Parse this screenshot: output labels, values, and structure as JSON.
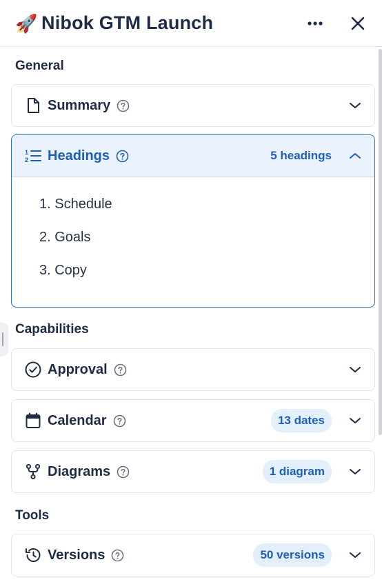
{
  "header": {
    "icon": "rocket-emoji",
    "emoji": "🚀",
    "title": "Nibok GTM Launch"
  },
  "sections": {
    "general": "General",
    "capabilities": "Capabilities",
    "tools": "Tools"
  },
  "summary": {
    "label": "Summary",
    "icon": "document-icon"
  },
  "headings": {
    "label": "Headings",
    "icon": "numbered-list-icon",
    "count": "5 headings",
    "expanded": true,
    "items": [
      "1. Schedule",
      "2. Goals",
      "3. Copy"
    ]
  },
  "approval": {
    "label": "Approval",
    "icon": "check-circle-icon"
  },
  "calendar": {
    "label": "Calendar",
    "icon": "calendar-icon",
    "badge": "13 dates"
  },
  "diagrams": {
    "label": "Diagrams",
    "icon": "branch-icon",
    "badge": "1 diagram"
  },
  "versions": {
    "label": "Versions",
    "icon": "history-icon",
    "badge": "50 versions"
  },
  "colors": {
    "accent": "#1d5fb8",
    "accent_bg": "#e9f2fd",
    "badge_bg": "#e4effc",
    "text": "#1f2a44",
    "border": "#e3e6ea"
  }
}
